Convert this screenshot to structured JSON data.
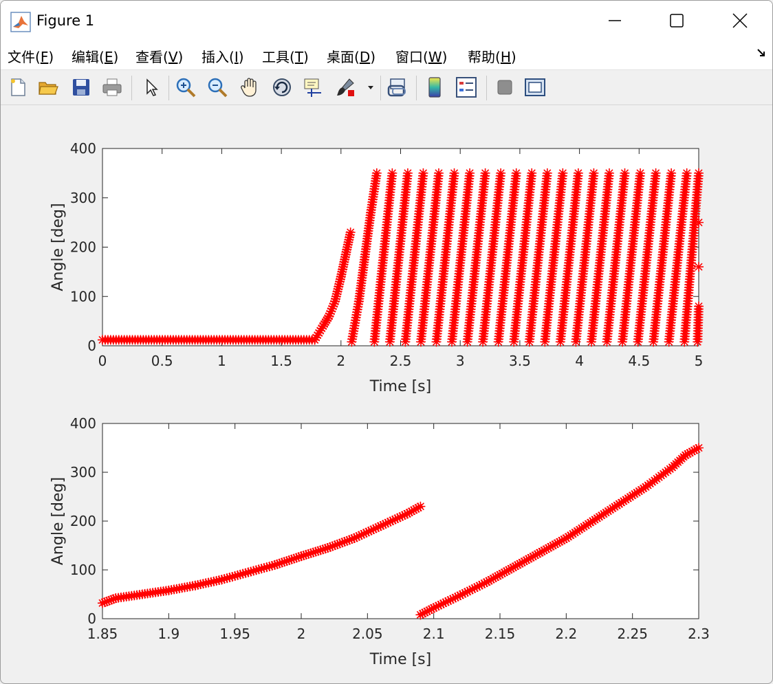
{
  "window": {
    "title": "Figure 1"
  },
  "menu": {
    "items": [
      {
        "text": "文件(",
        "key": "F",
        "tail": ")"
      },
      {
        "text": "编辑(",
        "key": "E",
        "tail": ")"
      },
      {
        "text": "查看(",
        "key": "V",
        "tail": ")"
      },
      {
        "text": "插入(",
        "key": "I",
        "tail": ")"
      },
      {
        "text": "工具(",
        "key": "T",
        "tail": ")"
      },
      {
        "text": "桌面(",
        "key": "D",
        "tail": ")"
      },
      {
        "text": "窗口(",
        "key": "W",
        "tail": ")"
      },
      {
        "text": "帮助(",
        "key": "H",
        "tail": ")"
      }
    ]
  },
  "toolbar": {
    "icons": [
      "new-figure-icon",
      "open-file-icon",
      "save-icon",
      "print-icon",
      "pointer-icon",
      "zoom-in-icon",
      "zoom-out-icon",
      "pan-hand-icon",
      "rotate-3d-icon",
      "data-cursor-icon",
      "brush-icon",
      "brush-dropdown-icon",
      "link-plot-icon",
      "colorbar-icon",
      "legend-icon",
      "hide-plot-tools-icon",
      "show-plot-tools-icon"
    ]
  },
  "colors": {
    "marker": "#ff0000",
    "axes_bg": "#ffffff",
    "figure_bg": "#f0f0f0"
  },
  "chart_data": [
    {
      "type": "scatter",
      "marker": "*",
      "color": "#ff0000",
      "xlabel": "Time [s]",
      "ylabel": "Angle [deg]",
      "xlim": [
        0,
        5
      ],
      "ylim": [
        0,
        400
      ],
      "xticks": [
        0,
        0.5,
        1,
        1.5,
        2,
        2.5,
        3,
        3.5,
        4,
        4.5,
        5
      ],
      "xtick_labels": [
        "0",
        "0.5",
        "1",
        "1.5",
        "2",
        "2.5",
        "3",
        "3.5",
        "4",
        "4.5",
        "5"
      ],
      "yticks": [
        0,
        100,
        200,
        300,
        400
      ],
      "ytick_labels": [
        "0",
        "100",
        "200",
        "300",
        "400"
      ],
      "series": [
        {
          "segments": [
            {
              "x": [
                0,
                1.78
              ],
              "y": [
                12,
                12
              ]
            },
            {
              "x": [
                1.78,
                1.85,
                1.9,
                1.95,
                2.0,
                2.04,
                2.08
              ],
              "y": [
                12,
                40,
                60,
                90,
                140,
                185,
                230
              ]
            },
            {
              "x": [
                2.09,
                2.15,
                2.2,
                2.25,
                2.3
              ],
              "y": [
                8,
                90,
                180,
                270,
                350
              ]
            },
            {
              "x": [
                2.28,
                2.43
              ],
              "y": [
                8,
                350
              ]
            },
            {
              "x": [
                2.41,
                2.56
              ],
              "y": [
                8,
                350
              ]
            },
            {
              "x": [
                2.54,
                2.69
              ],
              "y": [
                8,
                350
              ]
            },
            {
              "x": [
                2.67,
                2.82
              ],
              "y": [
                8,
                350
              ]
            },
            {
              "x": [
                2.8,
                2.95
              ],
              "y": [
                8,
                350
              ]
            },
            {
              "x": [
                2.93,
                3.08
              ],
              "y": [
                8,
                350
              ]
            },
            {
              "x": [
                3.06,
                3.21
              ],
              "y": [
                8,
                350
              ]
            },
            {
              "x": [
                3.19,
                3.34
              ],
              "y": [
                8,
                350
              ]
            },
            {
              "x": [
                3.32,
                3.47
              ],
              "y": [
                8,
                350
              ]
            },
            {
              "x": [
                3.45,
                3.6
              ],
              "y": [
                8,
                350
              ]
            },
            {
              "x": [
                3.58,
                3.73
              ],
              "y": [
                8,
                350
              ]
            },
            {
              "x": [
                3.71,
                3.86
              ],
              "y": [
                8,
                350
              ]
            },
            {
              "x": [
                3.84,
                3.99
              ],
              "y": [
                8,
                350
              ]
            },
            {
              "x": [
                3.97,
                4.12
              ],
              "y": [
                8,
                350
              ]
            },
            {
              "x": [
                4.1,
                4.25
              ],
              "y": [
                8,
                350
              ]
            },
            {
              "x": [
                4.23,
                4.38
              ],
              "y": [
                8,
                350
              ]
            },
            {
              "x": [
                4.36,
                4.51
              ],
              "y": [
                8,
                350
              ]
            },
            {
              "x": [
                4.49,
                4.64
              ],
              "y": [
                8,
                350
              ]
            },
            {
              "x": [
                4.62,
                4.77
              ],
              "y": [
                8,
                350
              ]
            },
            {
              "x": [
                4.75,
                4.9
              ],
              "y": [
                8,
                350
              ]
            },
            {
              "x": [
                4.88,
                5.0
              ],
              "y": [
                8,
                350
              ]
            },
            {
              "x": [
                4.99,
                5.0
              ],
              "y": [
                8,
                80
              ]
            }
          ],
          "points": [
            {
              "x": 5.0,
              "y": 250
            },
            {
              "x": 5.0,
              "y": 160
            }
          ]
        }
      ]
    },
    {
      "type": "scatter",
      "marker": "*",
      "color": "#ff0000",
      "xlabel": "Time [s]",
      "ylabel": "Angle [deg]",
      "xlim": [
        1.85,
        2.3
      ],
      "ylim": [
        0,
        400
      ],
      "xticks": [
        1.85,
        1.9,
        1.95,
        2.0,
        2.05,
        2.1,
        2.15,
        2.2,
        2.25,
        2.3
      ],
      "xtick_labels": [
        "1.85",
        "1.9",
        "1.95",
        "2",
        "2.05",
        "2.1",
        "2.15",
        "2.2",
        "2.25",
        "2.3"
      ],
      "yticks": [
        0,
        100,
        200,
        300,
        400
      ],
      "ytick_labels": [
        "0",
        "100",
        "200",
        "300",
        "400"
      ],
      "series": [
        {
          "segments": [
            {
              "x": [
                1.85,
                1.86,
                1.88,
                1.9,
                1.92,
                1.94,
                1.96,
                1.98,
                2.0,
                2.02,
                2.04,
                2.06,
                2.08,
                2.09
              ],
              "y": [
                32,
                42,
                50,
                58,
                68,
                80,
                95,
                110,
                128,
                145,
                165,
                190,
                215,
                230
              ]
            },
            {
              "x": [
                2.09,
                2.1,
                2.12,
                2.14,
                2.16,
                2.18,
                2.2,
                2.22,
                2.24,
                2.26,
                2.28,
                2.29,
                2.3
              ],
              "y": [
                8,
                22,
                48,
                75,
                105,
                135,
                165,
                200,
                235,
                270,
                310,
                335,
                350
              ]
            }
          ],
          "points": []
        }
      ]
    }
  ]
}
